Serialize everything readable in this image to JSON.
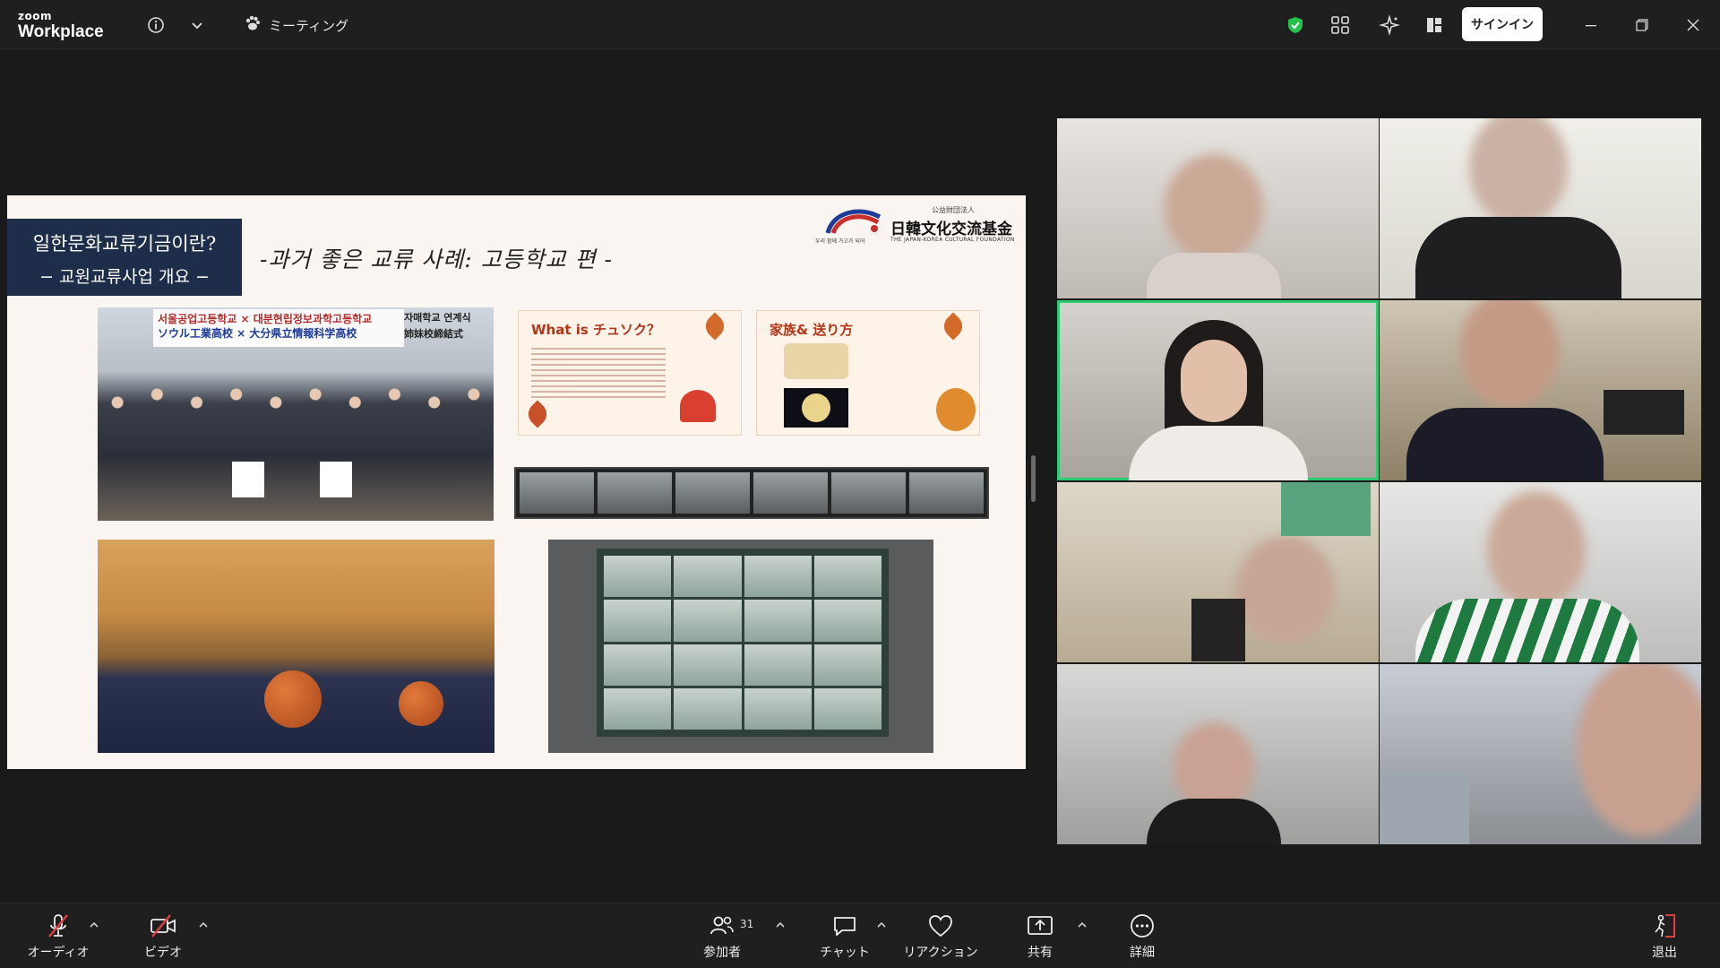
{
  "app": {
    "brand_small": "zoom",
    "brand_main": "Workplace"
  },
  "topbar": {
    "meeting_label": "ミーティング",
    "signin_label": "サインイン"
  },
  "slide": {
    "title_line1": "일한문화교류기금이란?",
    "title_line2": "− 교원교류사업 개요 −",
    "subtitle": "-과거 좋은 교류 사례: 고등학교 편 -",
    "logo_small": "公益財団法人",
    "logo_main": "日韓文化交流基金",
    "logo_en": "THE JAPAN-KOREA CULTURAL FOUNDATION",
    "logo_tag": "우리 함께 가고가 되어",
    "banner_line1": "서울공업고등학교 × 대분현립정보과학고등학교",
    "banner_line2": "ソウル工業高校 × 大分県立情報科学高校",
    "banner_right1": "자매학교 연계식",
    "banner_right2": "姉妹校締結式",
    "card1_title": "What is チュソク？",
    "card2_title": "家族& 送り方"
  },
  "toolbar": {
    "audio_label": "オーディオ",
    "video_label": "ビデオ",
    "participants_label": "参加者",
    "participants_count": "31",
    "chat_label": "チャット",
    "reaction_label": "リアクション",
    "share_label": "共有",
    "more_label": "詳細",
    "leave_label": "退出"
  },
  "colors": {
    "active_speaker": "#2ecc71",
    "leave": "#e03e3e",
    "mute": "#e03e3e",
    "slide_title_bg": "#1e2e4a"
  }
}
